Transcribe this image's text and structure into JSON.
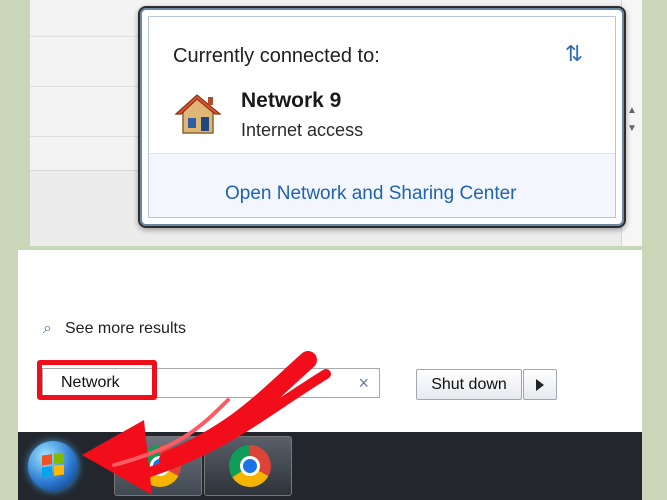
{
  "popup": {
    "title": "Currently connected to:",
    "network_name": "Network  9",
    "access_status": "Internet access",
    "footer_link": "Open Network and Sharing Center"
  },
  "start_menu": {
    "see_more_results": "See more results",
    "search_value": "Network",
    "shutdown_label": "Shut down"
  },
  "colors": {
    "link_blue": "#1f62b2",
    "highlight_red": "#f20d1a",
    "taskbar_dark": "#23272d"
  },
  "icons": {
    "refresh": "refresh-icon",
    "house": "house-network-icon",
    "search": "search-icon",
    "clear": "close-icon",
    "chevron": "chevron-right-icon",
    "start": "windows-start-icon",
    "chrome": "chrome-icon"
  }
}
